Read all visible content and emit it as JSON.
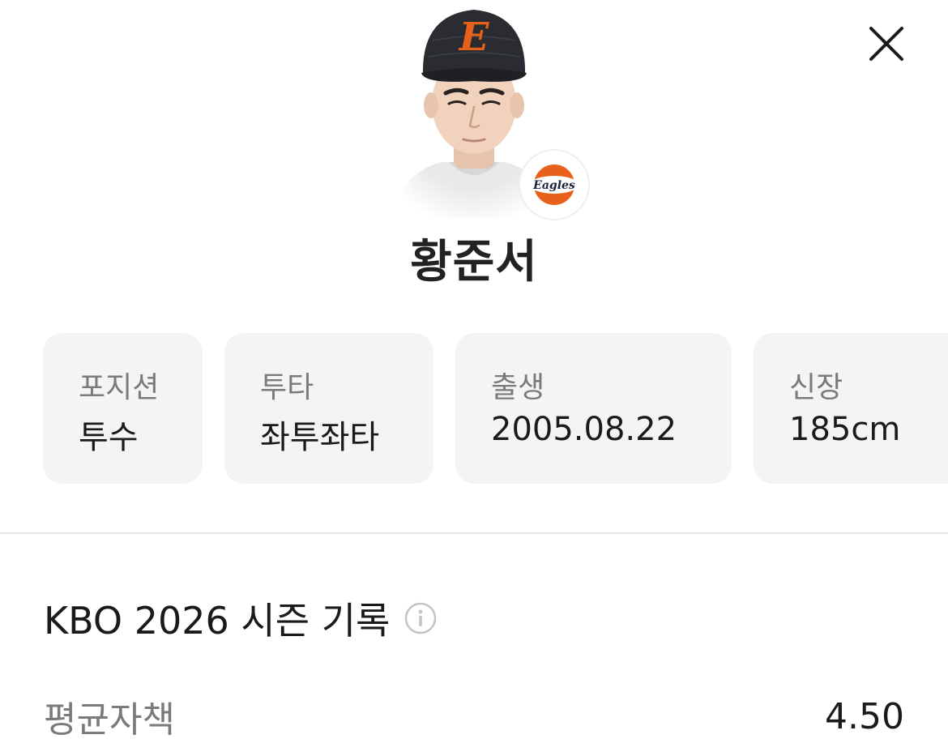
{
  "player": {
    "name": "황준서",
    "team_badge_text": "Eagles",
    "cap_letter": "E"
  },
  "info_cards": [
    {
      "label": "포지션",
      "value": "투수"
    },
    {
      "label": "투타",
      "value": "좌투좌타"
    },
    {
      "label": "출생",
      "value": "2005.08.22"
    },
    {
      "label": "신장",
      "value": "185cm"
    }
  ],
  "season": {
    "title": "KBO 2026 시즌 기록",
    "stats": [
      {
        "label": "평균자책",
        "value": "4.50"
      }
    ]
  },
  "colors": {
    "team_orange": "#e8611a",
    "card_bg": "#f4f4f4",
    "label_gray": "#7a7a7a"
  },
  "icons": {
    "close": "close-icon",
    "info": "info-icon"
  }
}
